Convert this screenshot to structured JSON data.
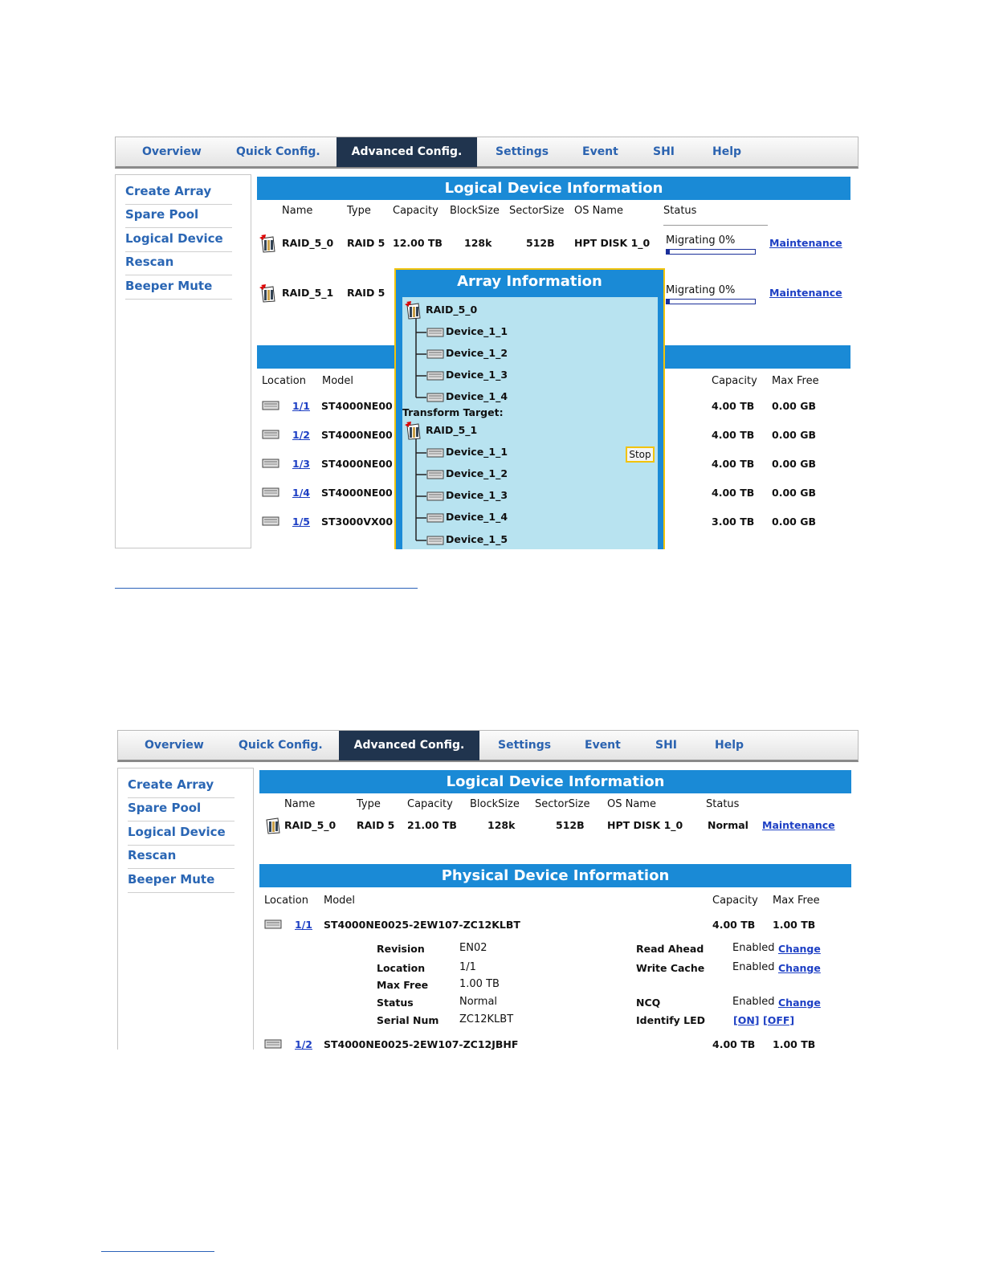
{
  "nav": {
    "tabs": [
      "Overview",
      "Quick Config.",
      "Advanced Config.",
      "Settings",
      "Event",
      "SHI",
      "Help"
    ],
    "active": "Advanced Config."
  },
  "sidebar": {
    "items": [
      "Create Array",
      "Spare Pool",
      "Logical Device",
      "Rescan",
      "Beeper Mute"
    ]
  },
  "colors": {
    "header_bar": "#1a8ad6",
    "active_tab": "#20344e",
    "link": "#1d3fc4",
    "popup_border": "#f2c30a",
    "popup_body": "#b8e3f0"
  },
  "screen1": {
    "logical_title": "Logical Device Information",
    "logical_headers": [
      "Name",
      "Type",
      "Capacity",
      "BlockSize",
      "SectorSize",
      "OS Name",
      "Status"
    ],
    "logical_rows": [
      {
        "name": "RAID_5_0",
        "type": "RAID 5",
        "capacity": "12.00 TB",
        "block": "128k",
        "sector": "512B",
        "os": "HPT DISK 1_0",
        "status": "Migrating 0%",
        "progress": 0,
        "action": "Maintenance"
      },
      {
        "name": "RAID_5_1",
        "type": "RAID 5",
        "status": "Migrating 0%",
        "progress": 0,
        "action": "Maintenance"
      }
    ],
    "physical_headers": {
      "location": "Location",
      "model": "Model",
      "capacity": "Capacity",
      "maxfree": "Max Free"
    },
    "physical_rows": [
      {
        "loc": "1/1",
        "model": "ST4000NE00",
        "capacity": "4.00 TB",
        "maxfree": "0.00 GB"
      },
      {
        "loc": "1/2",
        "model": "ST4000NE00",
        "capacity": "4.00 TB",
        "maxfree": "0.00 GB"
      },
      {
        "loc": "1/3",
        "model": "ST4000NE00",
        "capacity": "4.00 TB",
        "maxfree": "0.00 GB"
      },
      {
        "loc": "1/4",
        "model": "ST4000NE00",
        "capacity": "4.00 TB",
        "maxfree": "0.00 GB"
      },
      {
        "loc": "1/5",
        "model": "ST3000VX00",
        "capacity": "3.00 TB",
        "maxfree": "0.00 GB"
      }
    ],
    "popup": {
      "title": "Array Information",
      "source_array": "RAID_5_0",
      "source_devices": [
        "Device_1_1",
        "Device_1_2",
        "Device_1_3",
        "Device_1_4"
      ],
      "transform_label": "Transform Target:",
      "target_array": "RAID_5_1",
      "target_devices": [
        "Device_1_1",
        "Device_1_2",
        "Device_1_3",
        "Device_1_4",
        "Device_1_5"
      ],
      "stop_label": "Stop"
    }
  },
  "screen2": {
    "logical_title": "Logical Device Information",
    "logical_headers": [
      "Name",
      "Type",
      "Capacity",
      "BlockSize",
      "SectorSize",
      "OS Name",
      "Status"
    ],
    "logical_row": {
      "name": "RAID_5_0",
      "type": "RAID 5",
      "capacity": "21.00 TB",
      "block": "128k",
      "sector": "512B",
      "os": "HPT DISK 1_0",
      "status": "Normal",
      "action": "Maintenance"
    },
    "physical_title": "Physical Device Information",
    "physical_headers": {
      "location": "Location",
      "model": "Model",
      "capacity": "Capacity",
      "maxfree": "Max Free"
    },
    "disk1": {
      "loc": "1/1",
      "model": "ST4000NE0025-2EW107-ZC12KLBT",
      "capacity": "4.00 TB",
      "maxfree": "1.00 TB"
    },
    "details_left": [
      {
        "label": "Revision",
        "value": "EN02"
      },
      {
        "label": "Location",
        "value": "1/1"
      },
      {
        "label": "Max Free",
        "value": "1.00 TB"
      },
      {
        "label": "Status",
        "value": "Normal"
      },
      {
        "label": "Serial Num",
        "value": "ZC12KLBT"
      }
    ],
    "details_right": {
      "read_ahead": {
        "label": "Read Ahead",
        "value": "Enabled",
        "action": "Change"
      },
      "write_cache": {
        "label": "Write Cache",
        "value": "Enabled",
        "action": "Change"
      },
      "ncq": {
        "label": "NCQ",
        "value": "Enabled",
        "action": "Change"
      },
      "led": {
        "label": "Identify LED",
        "on": "[ON]",
        "off": "[OFF]"
      }
    },
    "disk2": {
      "loc": "1/2",
      "model": "ST4000NE0025-2EW107-ZC12JBHF",
      "capacity": "4.00 TB",
      "maxfree": "1.00 TB"
    }
  }
}
